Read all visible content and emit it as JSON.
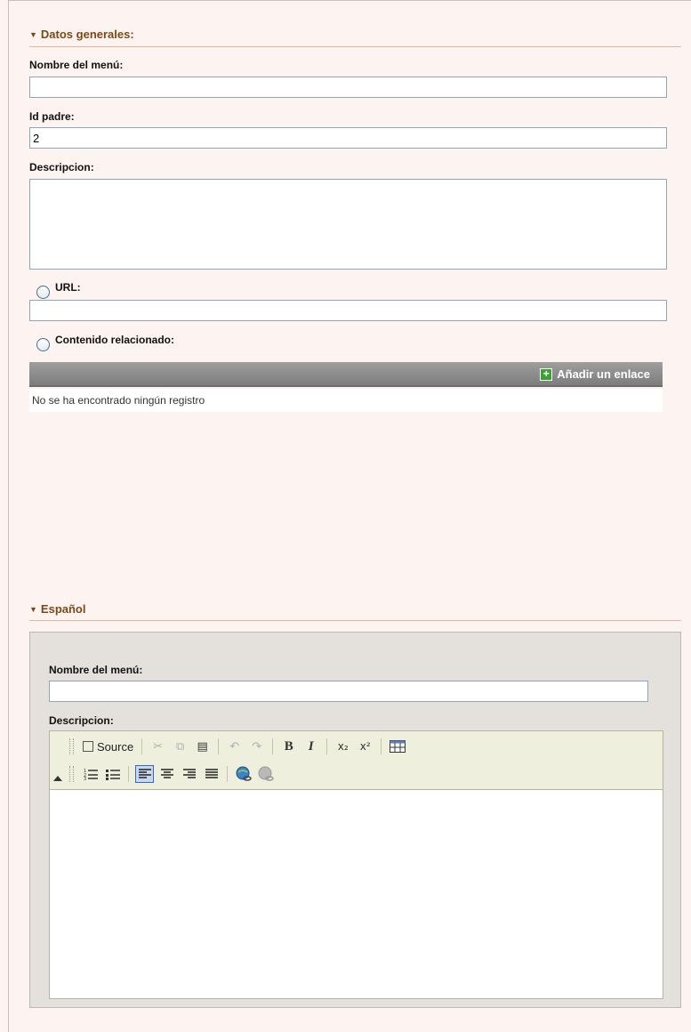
{
  "general": {
    "section_title": "Datos generales:",
    "name_label": "Nombre del menú:",
    "name_value": "",
    "parent_label": "Id padre:",
    "parent_value": "2",
    "description_label": "Descripcion:",
    "url_label": "URL:",
    "url_value": "",
    "related_label": "Contenido relacionado:",
    "add_link_label": "Añadir un enlace",
    "empty_message": "No se ha encontrado ningún registro"
  },
  "spanish": {
    "section_title": "Español",
    "name_label": "Nombre del menú:",
    "name_value": "",
    "description_label": "Descripcion:",
    "toolbar": {
      "row1": [
        "source",
        "cut-icon",
        "copy-icon",
        "paste-icon",
        "undo-icon",
        "redo-icon",
        "bold-icon",
        "italic-icon",
        "subscript-icon",
        "superscript-icon",
        "table-icon"
      ],
      "row2": [
        "ordered-list-icon",
        "unordered-list-icon",
        "align-left-icon",
        "align-center-icon",
        "align-right-icon",
        "justify-icon",
        "link-icon",
        "unlink-icon"
      ],
      "source_label": "Source"
    }
  },
  "colors": {
    "background": "#fdf4f1",
    "section_title": "#7a4a16",
    "grid_header": "#8a8a8a",
    "panel": "#e4e1dc",
    "toolbar": "#efefde",
    "add_icon": "#3aa232"
  }
}
